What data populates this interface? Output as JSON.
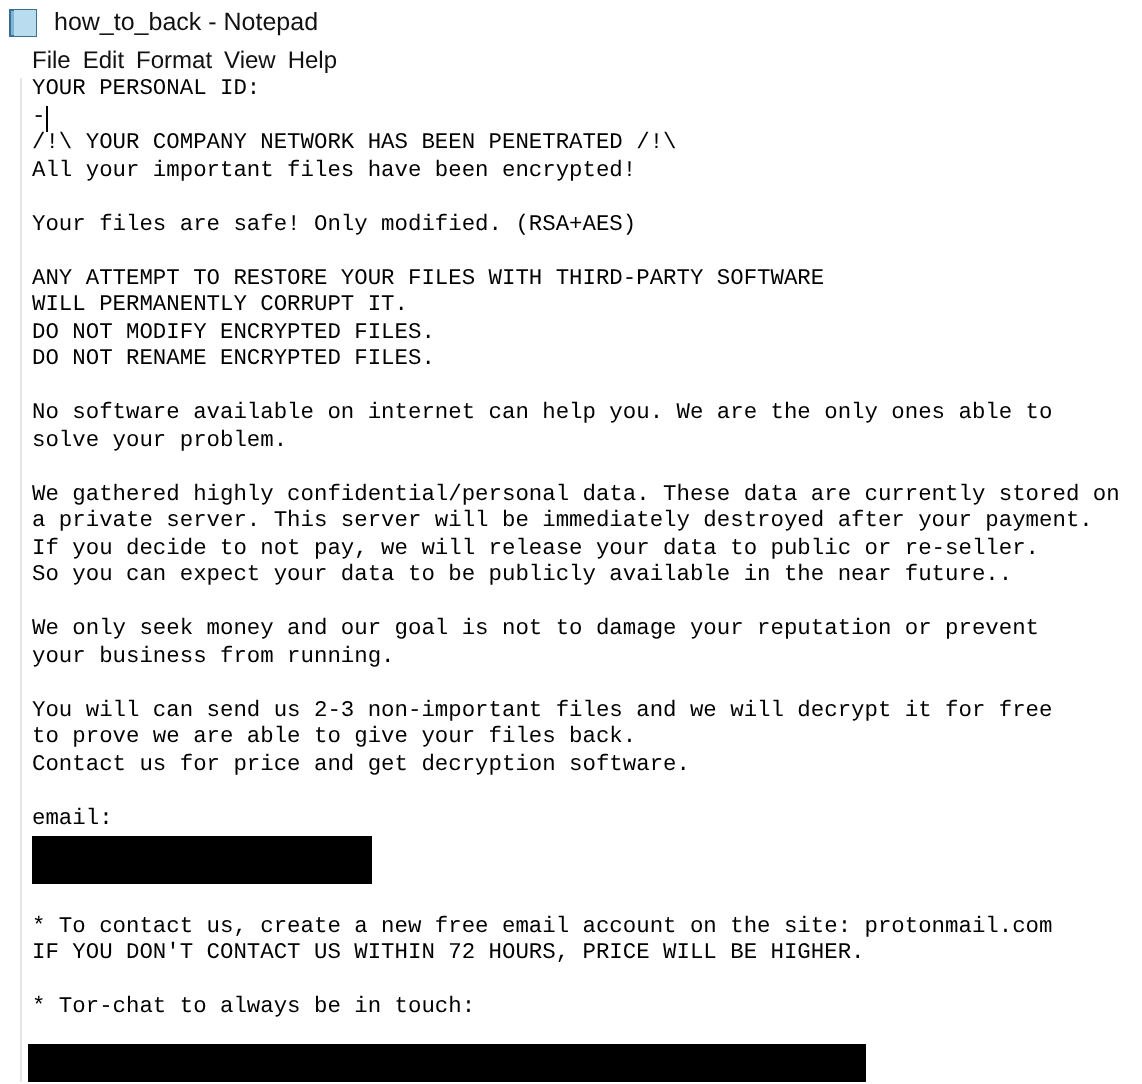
{
  "window": {
    "title": "how_to_back - Notepad"
  },
  "menu": [
    "File",
    "Edit",
    "Format",
    "View",
    "Help"
  ],
  "editor": {
    "lines": [
      {
        "kind": "text",
        "text": "YOUR PERSONAL ID:"
      },
      {
        "kind": "text",
        "text": "-",
        "caret": true
      },
      {
        "kind": "text",
        "text": "/!\\ YOUR COMPANY NETWORK HAS BEEN PENETRATED /!\\"
      },
      {
        "kind": "text",
        "text": "All your important files have been encrypted!"
      },
      {
        "kind": "blank"
      },
      {
        "kind": "text",
        "text": "Your files are safe! Only modified. (RSA+AES)"
      },
      {
        "kind": "blank"
      },
      {
        "kind": "text",
        "text": "ANY ATTEMPT TO RESTORE YOUR FILES WITH THIRD-PARTY SOFTWARE"
      },
      {
        "kind": "text",
        "text": "WILL PERMANENTLY CORRUPT IT."
      },
      {
        "kind": "text",
        "text": "DO NOT MODIFY ENCRYPTED FILES."
      },
      {
        "kind": "text",
        "text": "DO NOT RENAME ENCRYPTED FILES."
      },
      {
        "kind": "blank"
      },
      {
        "kind": "text",
        "text": "No software available on internet can help you. We are the only ones able to"
      },
      {
        "kind": "text",
        "text": "solve your problem."
      },
      {
        "kind": "blank"
      },
      {
        "kind": "text",
        "text": "We gathered highly confidential/personal data. These data are currently stored on"
      },
      {
        "kind": "text",
        "text": "a private server. This server will be immediately destroyed after your payment."
      },
      {
        "kind": "text",
        "text": "If you decide to not pay, we will release your data to public or re-seller."
      },
      {
        "kind": "text",
        "text": "So you can expect your data to be publicly available in the near future.."
      },
      {
        "kind": "blank"
      },
      {
        "kind": "text",
        "text": "We only seek money and our goal is not to damage your reputation or prevent"
      },
      {
        "kind": "text",
        "text": "your business from running."
      },
      {
        "kind": "blank"
      },
      {
        "kind": "text",
        "text": "You will can send us 2-3 non-important files and we will decrypt it for free"
      },
      {
        "kind": "text",
        "text": "to prove we are able to give your files back."
      },
      {
        "kind": "text",
        "text": "Contact us for price and get decryption software."
      },
      {
        "kind": "blank"
      },
      {
        "kind": "text",
        "text": "email:"
      },
      {
        "kind": "redacted"
      },
      {
        "kind": "blank"
      },
      {
        "kind": "text",
        "text": "* To contact us, create a new free email account on the site: protonmail.com"
      },
      {
        "kind": "text",
        "text": "IF YOU DON'T CONTACT US WITHIN 72 HOURS, PRICE WILL BE HIGHER."
      },
      {
        "kind": "blank"
      },
      {
        "kind": "text",
        "text": "* Tor-chat to always be in touch:"
      },
      {
        "kind": "redactedwide"
      }
    ]
  }
}
